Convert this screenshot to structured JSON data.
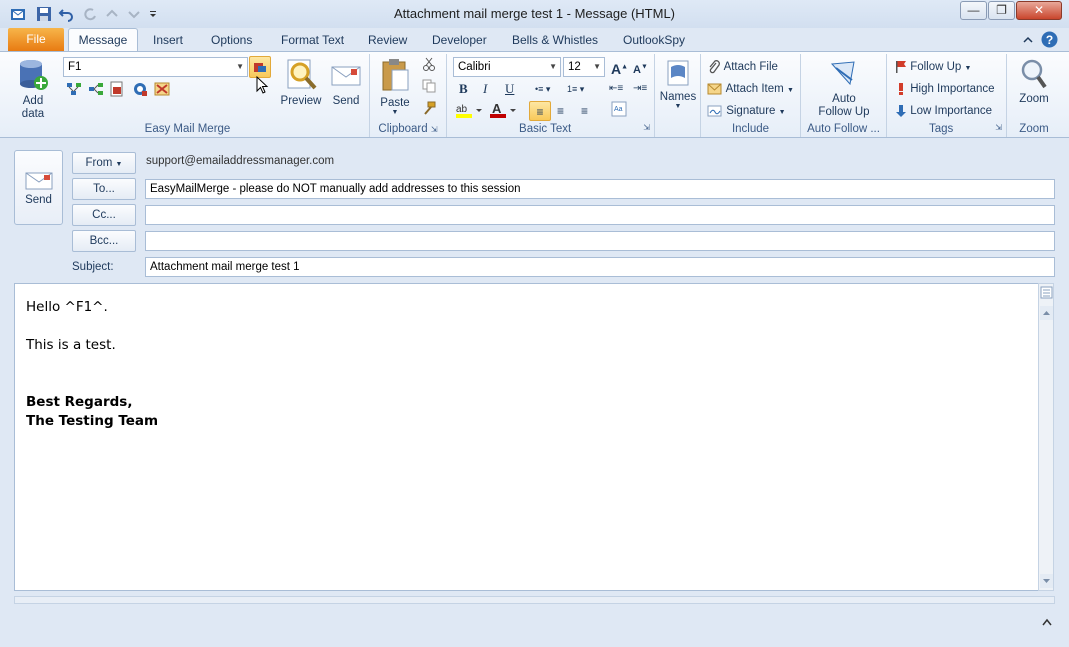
{
  "window": {
    "title": "Attachment mail merge test 1  -  Message (HTML)"
  },
  "tabs": [
    "File",
    "Message",
    "Insert",
    "Options",
    "Format Text",
    "Review",
    "Developer",
    "Bells & Whistles",
    "OutlookSpy"
  ],
  "ribbon": {
    "easy_mail_merge": {
      "label": "Easy Mail Merge",
      "add_data": "Add data",
      "field_value": "F1",
      "preview": "Preview",
      "send": "Send"
    },
    "clipboard": {
      "label": "Clipboard",
      "paste": "Paste"
    },
    "basic_text": {
      "label": "Basic Text",
      "font": "Calibri",
      "size": "12"
    },
    "names": {
      "label": "Names"
    },
    "include": {
      "label": "Include",
      "attach_file": "Attach File",
      "attach_item": "Attach Item",
      "signature": "Signature"
    },
    "auto_follow": {
      "label": "Auto Follow ...",
      "button": "Auto Follow Up"
    },
    "tags": {
      "label": "Tags",
      "follow_up": "Follow Up",
      "high": "High Importance",
      "low": "Low Importance"
    },
    "zoom": {
      "label": "Zoom",
      "button": "Zoom"
    }
  },
  "compose": {
    "send": "Send",
    "from_label": "From",
    "from_value": "support@emailaddressmanager.com",
    "to_label": "To...",
    "to_value": "EasyMailMerge - please do NOT manually add addresses to this session",
    "cc_label": "Cc...",
    "cc_value": "",
    "bcc_label": "Bcc...",
    "bcc_value": "",
    "subject_label": "Subject:",
    "subject_value": "Attachment mail merge test 1"
  },
  "body": {
    "line1": "Hello ^F1^.",
    "line2": "This is a test.",
    "sig1": "Best Regards,",
    "sig2": "The Testing Team"
  },
  "colors": {
    "file_tab": "#e87b12",
    "accent": "#1e395b"
  }
}
